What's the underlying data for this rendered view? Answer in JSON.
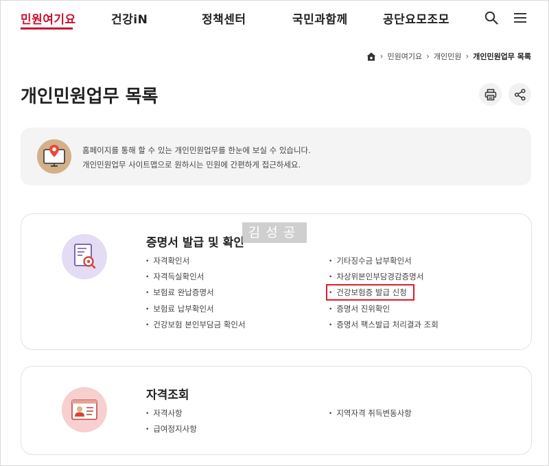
{
  "gnb": {
    "items": [
      "민원여기요",
      "건강iN",
      "정책센터",
      "국민과함께",
      "공단요모조모"
    ]
  },
  "breadcrumb": {
    "items": [
      "민원여기요",
      "개인민원",
      "개인민원업무 목록"
    ]
  },
  "page": {
    "title": "개인민원업무 목록"
  },
  "info": {
    "line1": "홈페이지를 통해 할 수 있는 개인민원업무를 한눈에 보실 수 있습니다.",
    "line2": "개인민원업무 사이트맵으로 원하시는 민원에 간편하게 접근하세요."
  },
  "sections": [
    {
      "title": "증명서 발급 및 확인",
      "left": [
        "자격확인서",
        "자격득실확인서",
        "보험료 완납증명서",
        "보험료 납부확인서",
        "건강보험 본인부담금 확인서"
      ],
      "right": [
        "기타징수금 납부확인서",
        "차상위본인부담경감증명서",
        "건강보험증 발급 신청",
        "증명서 진위확인",
        "증명서 팩스발급 처리결과 조회"
      ]
    },
    {
      "title": "자격조회",
      "left": [
        "자격사항",
        "급여정지사항"
      ],
      "right": [
        "지역자격 취득변동사항"
      ]
    }
  ],
  "watermark": "김성공",
  "colors": {
    "accent": "#c8102e",
    "highlight_box": "#e0192b",
    "info_bg": "#f4f4f4"
  }
}
